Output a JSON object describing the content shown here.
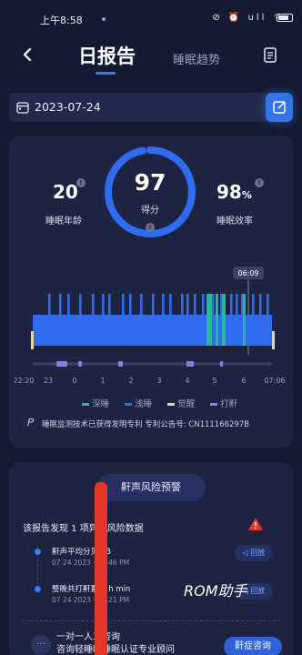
{
  "status_bar": {
    "time": "上午8:58",
    "icons_text": "⊘ ⏰ ull ⌔",
    "battery_level": 0.8
  },
  "header": {
    "title": "日报告",
    "tab_trend": "睡眠趋势"
  },
  "date": {
    "value": "2023-07-24"
  },
  "summary": {
    "sleep_age_value": "20",
    "sleep_age_label": "睡眠年龄",
    "score_value": "97",
    "score_label": "得分",
    "score_fraction": 0.97,
    "efficiency_value": "98",
    "efficiency_unit": "%",
    "efficiency_label": "睡眠效率",
    "info_mark": "!"
  },
  "chart_data": {
    "type": "bar",
    "cursor_label": "06:09",
    "x_ticks": [
      "22:20",
      "23",
      "0",
      "1",
      "2",
      "3",
      "4",
      "5",
      "6",
      "07:06"
    ],
    "legend": [
      "深睡",
      "浅睡",
      "觉醒",
      "打鼾"
    ],
    "colors": {
      "深睡": "#27b89a",
      "浅睡": "#2f6cf0",
      "觉醒": "#e6d7a8",
      "打鼾": "#8b7ee0"
    }
  },
  "patent": {
    "text": "睡眠监测技术已获得发明专利   专利公告号: CN111166297B"
  },
  "risk": {
    "button_label": "鼾声风险预警",
    "found_text": "该报告发现 1 项异常风险数据",
    "records": [
      {
        "title": "鼾声平均分贝    dB",
        "time": "07 24 2023 · 22:46 PM",
        "button": "◁ 回放"
      },
      {
        "title": "整晚共打鼾累计    h    min",
        "time": "07 24 2023 · 22:21 PM",
        "button": "◁ 回放"
      }
    ],
    "consult_text_1": "一对一人工咨询",
    "consult_text_2": "咨询轻睡眠睡眠认证专业顾问",
    "consult_button": "鼾症咨询"
  },
  "watermark": "ROM助手"
}
